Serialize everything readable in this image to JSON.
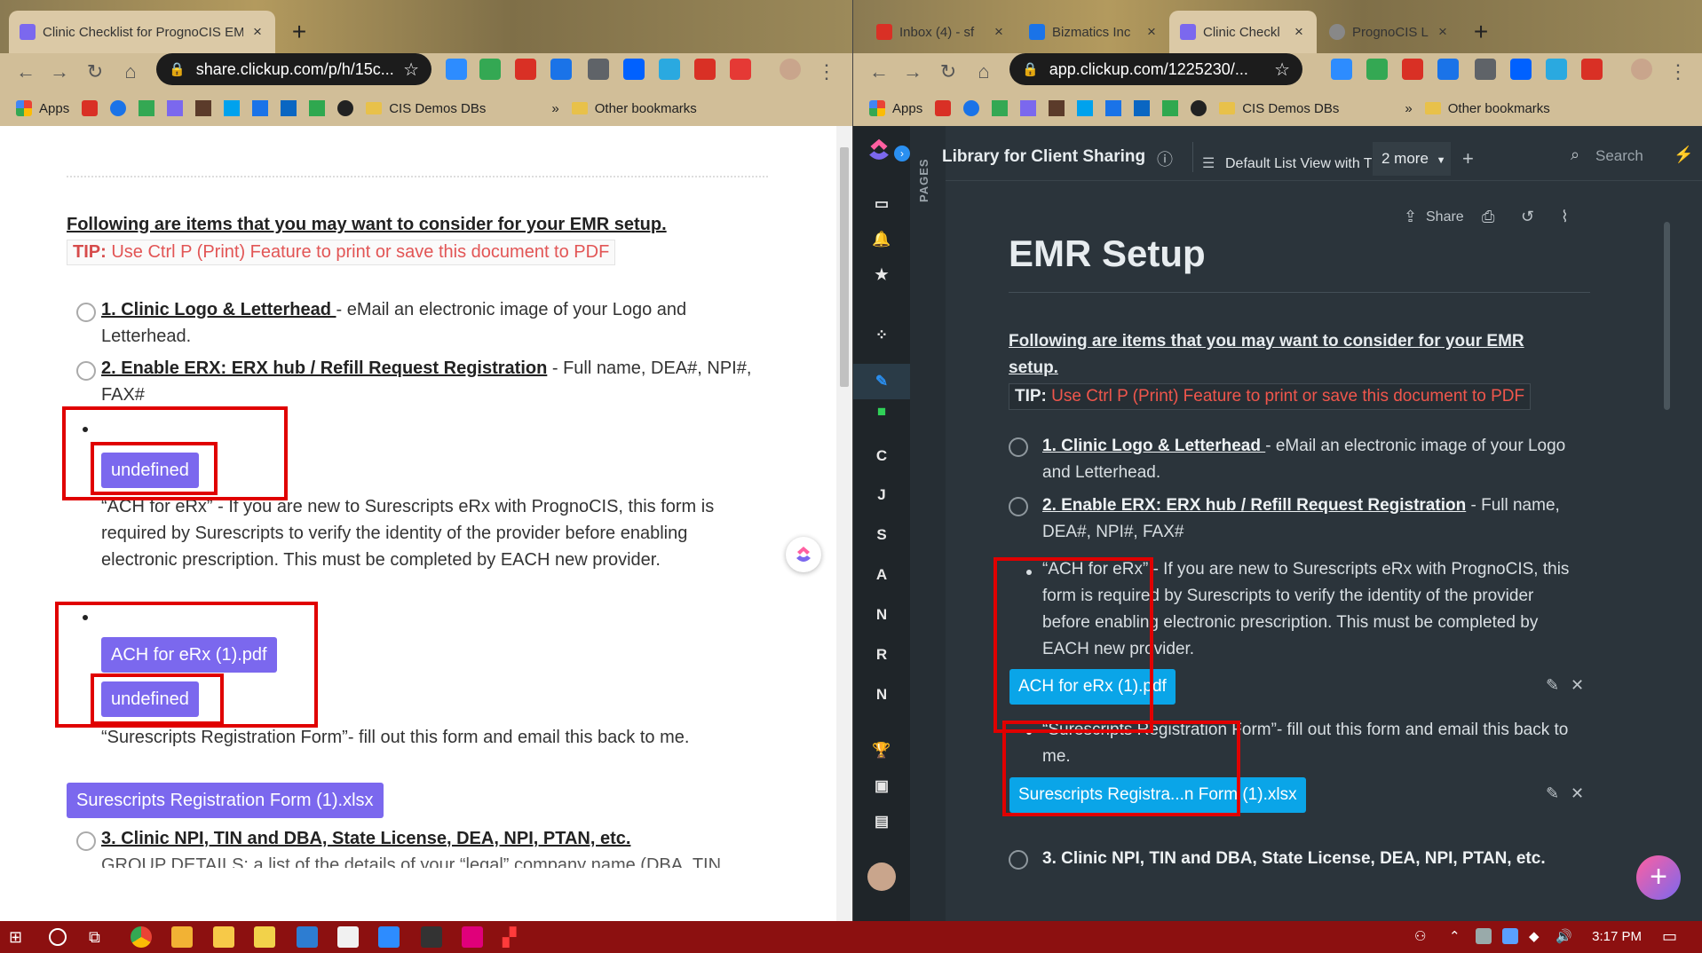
{
  "left_browser": {
    "tabs": [
      {
        "title": "Clinic Checklist for PrognoCIS EM",
        "close": "×"
      }
    ],
    "new_tab": "+",
    "url": "share.clickup.com/p/h/15c...",
    "bookmarks": [
      "Apps",
      "CIS Demos DBs",
      "Other bookmarks"
    ],
    "bookmarks_more": "»"
  },
  "left_page": {
    "heading": "Following are items that you may want to consider for your EMR setup.",
    "tip_label": "TIP:",
    "tip_text": "Use Ctrl P (Print) Feature to print or save this document to PDF",
    "item1_title": "1. Clinic Logo & Letterhead ",
    "item1_text": "- eMail an electronic image of your Logo and Letterhead.",
    "item2_title": "2. Enable ERX: ERX hub / Refill Request Registration",
    "item2_text": " - Full name, DEA#, NPI#, FAX#",
    "undefined_label": "undefined",
    "ach_para": "“ACH for eRx” - If you are new to Surescripts eRx with PrognoCIS, this form is required by Surescripts to verify the identity of the provider before enabling electronic prescription. This must be completed by EACH new provider.",
    "ach_file": "ACH for eRx (1).pdf",
    "surescripts_para": "“Surescripts Registration Form”- fill out this form and email this back to me.",
    "surescripts_file": "Surescripts Registration Form (1).xlsx",
    "item3_title": "3. Clinic NPI, TIN and DBA, State License, DEA, NPI, PTAN, etc. ",
    "item3_cut": "GROUP DETAILS: a list of the details of your “legal” company name (DBA, TIN"
  },
  "right_browser": {
    "tabs": [
      {
        "title": "Inbox (4) - sf",
        "close": "×"
      },
      {
        "title": "Bizmatics Inc",
        "close": "×"
      },
      {
        "title": "Clinic Checkl",
        "close": "×"
      },
      {
        "title": "PrognoCIS L",
        "close": "×"
      }
    ],
    "new_tab": "+",
    "url": "app.clickup.com/1225230/...",
    "bookmarks": [
      "Apps",
      "CIS Demos DBs",
      "Other bookmarks"
    ],
    "bookmarks_more": "»"
  },
  "right_app": {
    "workspace_title": "Library for Client Sharing",
    "view_name": "Default List View with T",
    "more_views": "2 more",
    "search_placeholder": "Search",
    "pages_label": "PAGES",
    "rail_letters": [
      "C",
      "J",
      "S",
      "A",
      "N",
      "R",
      "N"
    ],
    "share_label": "Share",
    "doc_title": "EMR Setup",
    "heading": "Following are items that you may want to consider for your EMR setup.",
    "tip_label": "TIP:",
    "tip_text": "Use Ctrl P (Print) Feature to print or save this document to PDF",
    "item1_title": "1. Clinic Logo & Letterhead ",
    "item1_text": "- eMail an electronic image of your Logo and Letterhead.",
    "item2_title": "2. Enable ERX: ERX hub / Refill Request Registration",
    "item2_text": " - Full name, DEA#, NPI#, FAX#",
    "ach_para": "“ACH for eRx” - If you are new to Surescripts eRx with PrognoCIS, this form is required by Surescripts to verify the identity of the provider before enabling electronic prescription. This must be completed by EACH new provider.",
    "ach_file": "ACH for eRx (1).pdf",
    "surescripts_para": "“Surescripts Registration Form”- fill out this form and email this back to me.",
    "surescripts_file": "Surescripts Registra...n Form (1).xlsx",
    "item3_title": "3. Clinic NPI, TIN and DBA, State License, DEA, NPI, PTAN, etc.",
    "fab": "+"
  },
  "taskbar": {
    "time": "3:17 PM"
  },
  "colors": {
    "clickup_purple": "#7b68ee",
    "clickup_blue": "#0aa5e8",
    "highlight_red": "#e00000",
    "taskbar": "#8c1010"
  }
}
